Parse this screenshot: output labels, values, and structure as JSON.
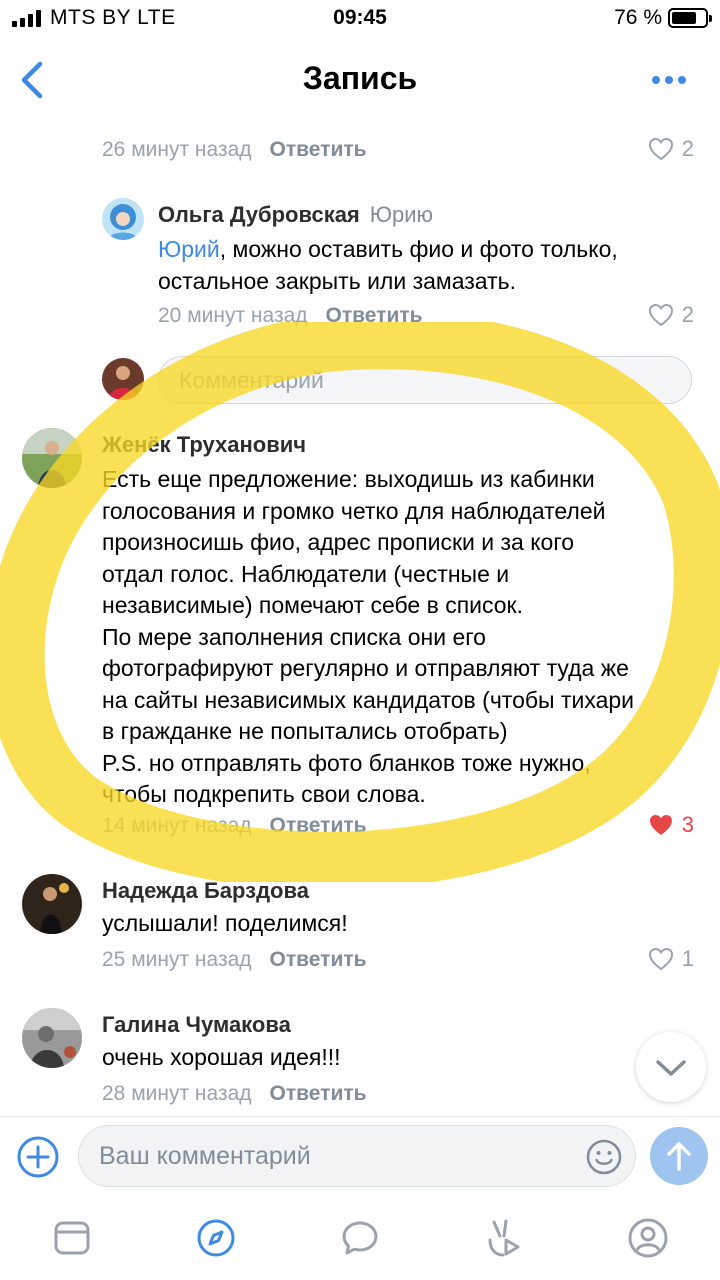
{
  "status_bar": {
    "carrier": "MTS BY   LTE",
    "time": "09:45",
    "battery": "76 %",
    "battery_level": 0.76
  },
  "nav": {
    "title": "Запись"
  },
  "comments": [
    {
      "time": "26 минут назад",
      "reply_label": "Ответить",
      "likes": "2"
    },
    {
      "author": "Ольга Дубровская",
      "reply_to": "Юрию",
      "mention": "Юрий",
      "text_line1": ", можно оставить фио и фото только,",
      "text_line2": "остальное закрыть или замазать.",
      "time": "20 минут назад",
      "reply_label": "Ответить",
      "likes": "2"
    },
    {
      "author": "Женёк Труханович",
      "lines": [
        "Есть еще предложение: выходишь из кабинки",
        "голосования и громко четко для наблюдателей",
        "произносишь фио, адрес прописки и за кого",
        "отдал голос. Наблюдатели (честные и",
        "независимые) помечают себе в список.",
        "По мере заполнения списка они его",
        "фотографируют регулярно и отправляют туда же",
        "на сайты независимых кандидатов (чтобы тихари",
        "в гражданке не попытались отобрать)",
        "P.S. но отправлять фото бланков тоже нужно,",
        "чтобы подкрепить свои слова."
      ],
      "time": "14 минут назад",
      "reply_label": "Ответить",
      "likes": "3"
    },
    {
      "author": "Надежда Барздова",
      "text": "услышали! поделимся!",
      "time": "25 минут назад",
      "reply_label": "Ответить",
      "likes": "1"
    },
    {
      "author": "Галина Чумакова",
      "text": "очень хорошая идея!!!",
      "time": "28 минут назад",
      "reply_label": "Ответить"
    }
  ],
  "reply_box": {
    "placeholder": "Комментарий"
  },
  "composer": {
    "placeholder": "Ваш комментарий"
  },
  "colors": {
    "accent": "#3f8ae0",
    "like_active": "#e64646",
    "secondary_text": "#818c99",
    "highlight": "#f7d724"
  },
  "tabs": [
    "news-icon",
    "discover-icon",
    "messages-icon",
    "clips-icon",
    "profile-icon"
  ]
}
